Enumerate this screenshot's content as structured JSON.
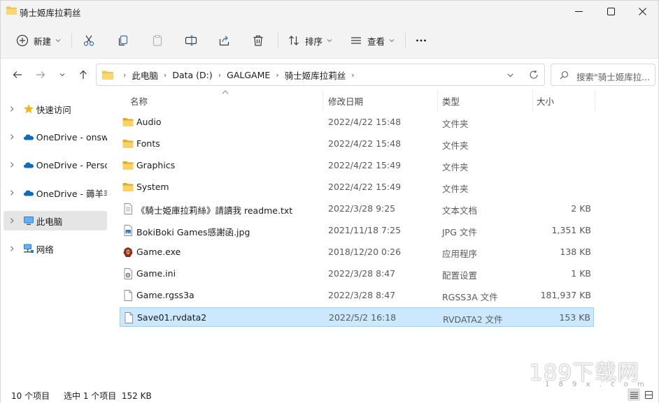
{
  "window": {
    "title": "骑士姬库拉莉丝"
  },
  "toolbar": {
    "new_label": "新建",
    "sort_label": "排序",
    "view_label": "查看",
    "more_label": "···"
  },
  "address": {
    "crumbs": [
      "此电脑",
      "Data (D:)",
      "GALGAME",
      "骑士姬库拉莉丝"
    ],
    "search_placeholder": "搜索\"骑士姬库拉..."
  },
  "nav_pane": {
    "items": [
      {
        "label": "快速访问",
        "icon": "star-icon"
      },
      {
        "label": "OneDrive - onswe",
        "icon": "cloud-icon"
      },
      {
        "label": "OneDrive - Persor",
        "icon": "cloud-icon"
      },
      {
        "label": "OneDrive - 薅羊毛",
        "icon": "cloud-icon"
      },
      {
        "label": "此电脑",
        "icon": "computer-icon",
        "selected": true
      },
      {
        "label": "网络",
        "icon": "network-icon"
      }
    ]
  },
  "columns": {
    "name": "名称",
    "date": "修改日期",
    "type": "类型",
    "size": "大小"
  },
  "files": [
    {
      "name": "Audio",
      "date": "2022/4/22 15:48",
      "type": "文件夹",
      "size": "",
      "icon": "folder-icon"
    },
    {
      "name": "Fonts",
      "date": "2022/4/22 15:48",
      "type": "文件夹",
      "size": "",
      "icon": "folder-icon"
    },
    {
      "name": "Graphics",
      "date": "2022/4/22 15:49",
      "type": "文件夹",
      "size": "",
      "icon": "folder-icon"
    },
    {
      "name": "System",
      "date": "2022/4/22 15:49",
      "type": "文件夹",
      "size": "",
      "icon": "folder-icon"
    },
    {
      "name": "《騎士姫庫拉莉絲》請讀我 readme.txt",
      "date": "2022/3/28 9:25",
      "type": "文本文档",
      "size": "2 KB",
      "icon": "text-file-icon"
    },
    {
      "name": "BokiBoki Games感謝函.jpg",
      "date": "2021/11/18 7:25",
      "type": "JPG 文件",
      "size": "1,351 KB",
      "icon": "image-file-icon"
    },
    {
      "name": "Game.exe",
      "date": "2018/12/20 0:26",
      "type": "应用程序",
      "size": "138 KB",
      "icon": "exe-icon"
    },
    {
      "name": "Game.ini",
      "date": "2022/3/28 8:47",
      "type": "配置设置",
      "size": "1 KB",
      "icon": "settings-file-icon"
    },
    {
      "name": "Game.rgss3a",
      "date": "2022/3/28 8:47",
      "type": "RGSS3A 文件",
      "size": "181,937 KB",
      "icon": "blank-file-icon"
    },
    {
      "name": "Save01.rvdata2",
      "date": "2022/5/2 16:18",
      "type": "RVDATA2 文件",
      "size": "153 KB",
      "icon": "blank-file-icon",
      "selected": true
    }
  ],
  "status": {
    "item_count": "10 个项目",
    "selection": "选中 1 个项目  152 KB"
  },
  "watermark": {
    "text": "189下载网",
    "sub": "1 8 9 x . c o m"
  },
  "colors": {
    "folder": "#f4c542",
    "selection_bg": "#cce8ff",
    "selection_border": "#99d1ff",
    "onedrive": "#0f6cbd"
  }
}
